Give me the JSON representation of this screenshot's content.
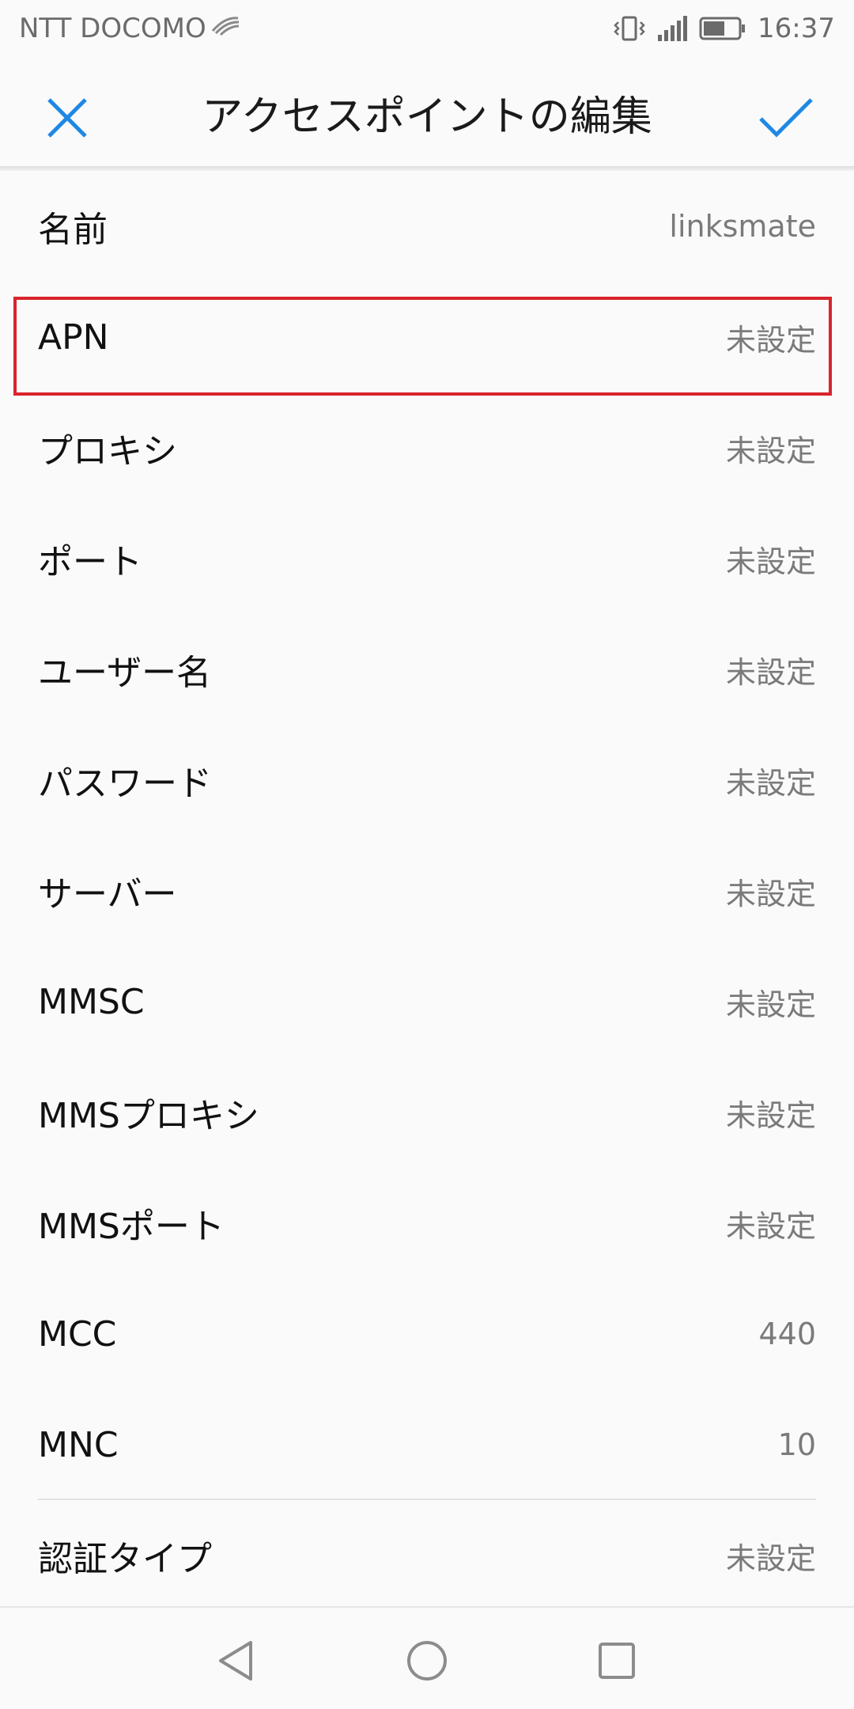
{
  "status_bar": {
    "carrier": "NTT DOCOMO",
    "time": "16:37",
    "icons": [
      "swift-icon",
      "vibrate-icon",
      "signal-icon",
      "battery-icon"
    ]
  },
  "toolbar": {
    "title": "アクセスポイントの編集",
    "close_icon": "close-icon",
    "confirm_icon": "check-icon",
    "accent_color": "#1e88e5"
  },
  "fields": [
    {
      "label": "名前",
      "value": "linksmate"
    },
    {
      "label": "APN",
      "value": "未設定"
    },
    {
      "label": "プロキシ",
      "value": "未設定"
    },
    {
      "label": "ポート",
      "value": "未設定"
    },
    {
      "label": "ユーザー名",
      "value": "未設定"
    },
    {
      "label": "パスワード",
      "value": "未設定"
    },
    {
      "label": "サーバー",
      "value": "未設定"
    },
    {
      "label": "MMSC",
      "value": "未設定"
    },
    {
      "label": "MMSプロキシ",
      "value": "未設定"
    },
    {
      "label": "MMSポート",
      "value": "未設定"
    },
    {
      "label": "MCC",
      "value": "440"
    },
    {
      "label": "MNC",
      "value": "10"
    },
    {
      "label": "認証タイプ",
      "value": "未設定"
    }
  ],
  "highlight_color": "#d9242c",
  "nav_bar": {
    "icons": [
      "back-icon",
      "home-icon",
      "recent-apps-icon"
    ]
  }
}
